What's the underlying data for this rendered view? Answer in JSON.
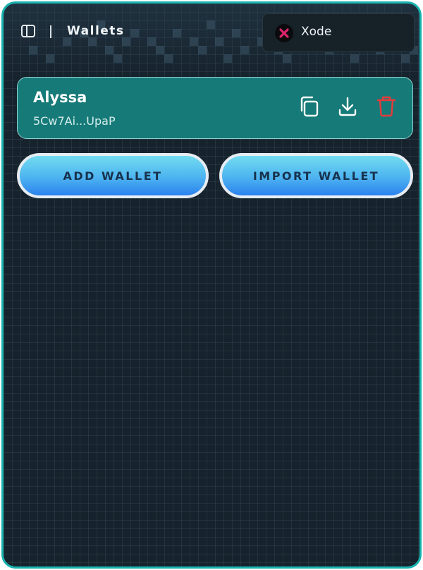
{
  "header": {
    "title": "Wallets",
    "sidebar_icon": "sidebar-toggle-icon",
    "network": {
      "label": "Xode",
      "icon": "xode-logo-icon",
      "icon_color": "#e0246c"
    }
  },
  "wallet": {
    "name": "Alyssa",
    "address": "5Cw7Ai...UpaP",
    "actions": [
      {
        "icon": "copy-icon"
      },
      {
        "icon": "download-icon"
      },
      {
        "icon": "trash-icon",
        "color": "#e53b3b"
      }
    ]
  },
  "buttons": {
    "add_wallet": "ADD WALLET",
    "import_wallet": "IMPORT WALLET"
  },
  "theme": {
    "background": "#16222c",
    "frame_border": "#17b4b0",
    "card": "#167a78",
    "button_gradient": [
      "#71dcf0",
      "#2b82ee"
    ]
  }
}
